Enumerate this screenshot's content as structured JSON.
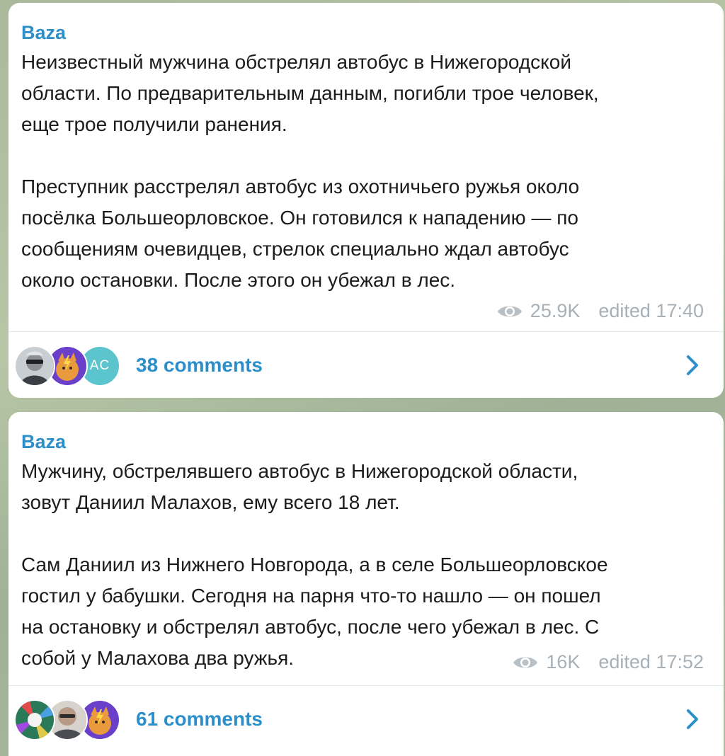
{
  "posts": [
    {
      "channel": "Baza",
      "paragraphs": [
        "Неизвестный мужчина обстрелял автобус в Нижегородской\nобласти. По предварительным данным, погибли трое человек,\nеще трое получили ранения.",
        "Преступник расстрелял автобус из охотничьего ружья около\nпосёлка Большеорловское. Он готовился к нападению — по\nсообщениям очевидцев, стрелок специально ждал автобус\nоколо остановки. После этого он убежал в лес."
      ],
      "views": "25.9K",
      "edited": "edited 17:40",
      "comments_label": "38 comments",
      "avatars": [
        {
          "icon": "avatar-photo-man-sunglasses",
          "colors": [
            "#3b3f45",
            "#c9ced3"
          ]
        },
        {
          "icon": "avatar-cartoon-fox-lightning",
          "colors": [
            "#6a3fc9",
            "#e89a3c"
          ]
        },
        {
          "icon": "avatar-initials",
          "initials": "AC",
          "colors": [
            "#5cc4cd"
          ]
        }
      ]
    },
    {
      "channel": "Baza",
      "paragraphs": [
        "Мужчину, обстрелявшего автобус в Нижегородской области,\nзовут Даниил Малахов, ему всего 18 лет.",
        "Сам Даниил из Нижнего Новгорода, а в селе Большеорловское\nгостил у бабушки. Сегодня на парня что-то нашло — он пошел\nна остановку и обстрелял автобус, после чего убежал в лес. С\nсобой у Малахова два ружья."
      ],
      "views": "16K",
      "edited": "edited 17:52",
      "comments_label": "61 comments",
      "avatars": [
        {
          "icon": "avatar-photo-colorful-light",
          "colors": [
            "#2a7a5a",
            "#e04a4a"
          ]
        },
        {
          "icon": "avatar-photo-man-bald",
          "colors": [
            "#4a4d52",
            "#d8d2cc"
          ]
        },
        {
          "icon": "avatar-cartoon-fox-lightning",
          "colors": [
            "#6a3fc9",
            "#e89a3c"
          ]
        }
      ]
    }
  ],
  "icons": {
    "views": "eye-icon",
    "open_comments": "chevron-right-icon"
  },
  "colors": {
    "accent": "#2d8fca",
    "meta_text": "#a8b0b6",
    "text": "#1c1c1c"
  }
}
